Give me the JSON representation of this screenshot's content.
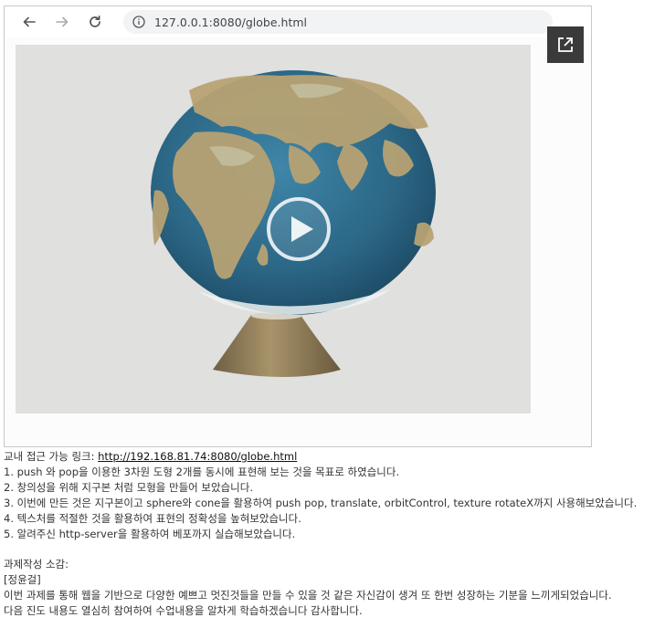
{
  "browser": {
    "url": "127.0.0.1:8080/globe.html"
  },
  "icons": {
    "back": "arrow-left-icon",
    "forward": "arrow-right-icon",
    "reload": "reload-icon",
    "info": "info-circle-icon",
    "open_external": "open-in-new-icon",
    "play": "play-icon"
  },
  "colors": {
    "ocean": "#2f6e8e",
    "land": "#b9a47a",
    "cone": "#8b7a5a",
    "canvas_bg": "#e0e0de",
    "overlay_button": "#3a3a3a"
  },
  "post": {
    "link_prefix": "교내 접근 가능 링크: ",
    "link_text": "http://192.168.81.74:8080/globe.html",
    "items": [
      "1. push 와 pop을 이용한 3차원 도형 2개를 동시에 표현해 보는 것을 목표로 하였습니다.",
      "2. 창의성을 위해 지구본 처럼 모형을 만들어 보았습니다.",
      "3. 이번에 만든 것은 지구본이고 sphere와 cone을 활용하여 push pop, translate, orbitControl, texture rotateX까지 사용해보았습니다.",
      "4. 텍스처를 적절한 것을 활용하여 표현의 정확성을 높혀보았습니다.",
      "5. 알려주신 http-server을 활용하여 베포까지 실습해보았습니다."
    ],
    "review_heading": "과제작성 소감:",
    "author": "[정윤걸]",
    "review_lines": [
      "이번 과제를 통해 웹을 기반으로 다양한 예쁘고 멋진것들을 만들 수 있을 것 같은 자신감이 생겨 또 한번 성장하는 기분을 느끼게되었습니다.",
      "다음 진도 내용도 열심히 참여하여 수업내용을 알차게 학습하겠습니다 감사합니다."
    ]
  }
}
